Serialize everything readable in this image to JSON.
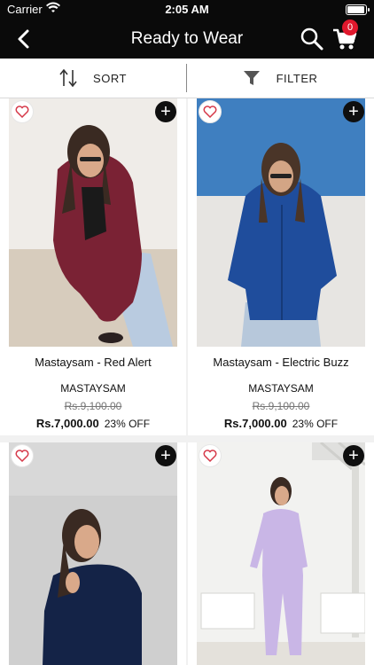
{
  "status_bar": {
    "carrier": "Carrier",
    "time": "2:05 AM"
  },
  "nav": {
    "title": "Ready to Wear",
    "cart_count": "0"
  },
  "toolbar": {
    "sort_label": "SORT",
    "filter_label": "FILTER"
  },
  "products": [
    {
      "name": "Mastaysam - Red Alert",
      "brand": "MASTAYSAM",
      "old_price": "Rs.9,100.00",
      "price": "Rs.7,000.00",
      "discount": "23% OFF"
    },
    {
      "name": "Mastaysam - Electric Buzz",
      "brand": "MASTAYSAM",
      "old_price": "Rs.9,100.00",
      "price": "Rs.7,000.00",
      "discount": "23% OFF"
    }
  ],
  "colors": {
    "header_bg": "#0a0a0a",
    "badge": "#e0182d",
    "heart_outline": "#d63a4a"
  }
}
